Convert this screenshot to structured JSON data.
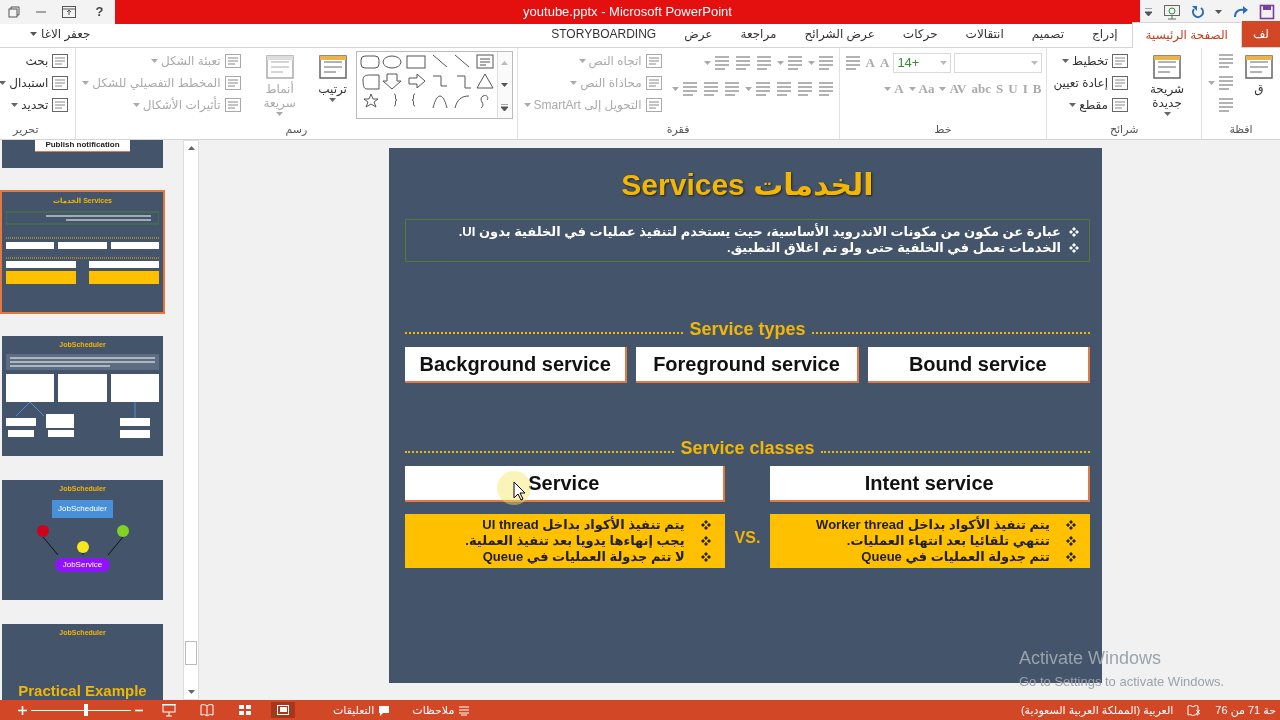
{
  "window": {
    "title": "youtube.pptx -  Microsoft PowerPoint",
    "help_label": "?"
  },
  "account": {
    "name": "جعفر الاغا"
  },
  "tabs": [
    {
      "label": "لف",
      "selected": false,
      "kind": "file"
    },
    {
      "label": "الصفحة الرئيسية",
      "selected": true,
      "kind": "tab"
    },
    {
      "label": "إدراج",
      "selected": false,
      "kind": "tab"
    },
    {
      "label": "تصميم",
      "selected": false,
      "kind": "tab"
    },
    {
      "label": "انتقالات",
      "selected": false,
      "kind": "tab"
    },
    {
      "label": "حركات",
      "selected": false,
      "kind": "tab"
    },
    {
      "label": "عرض الشرائح",
      "selected": false,
      "kind": "tab"
    },
    {
      "label": "مراجعة",
      "selected": false,
      "kind": "tab"
    },
    {
      "label": "عرض",
      "selected": false,
      "kind": "tab"
    },
    {
      "label": "STORYBOARDING",
      "selected": false,
      "kind": "tab"
    }
  ],
  "ribbon": [
    {
      "label": "افظة",
      "columns": [
        [
          {
            "kind": "large",
            "label": "ق",
            "menu": false,
            "disabled": false
          }
        ],
        [
          {
            "kind": "icon",
            "disabled": true
          },
          {
            "kind": "icon",
            "disabled": true,
            "menu": true
          },
          {
            "kind": "icon",
            "disabled": true
          }
        ]
      ]
    },
    {
      "label": "شرائح",
      "columns": [
        [
          {
            "kind": "large",
            "label": "شريحة جديدة",
            "menu": true,
            "disabled": false
          }
        ],
        [
          {
            "kind": "small",
            "label": "تخطيط",
            "menu": true,
            "disabled": false
          },
          {
            "kind": "small",
            "label": "إعادة تعيين",
            "menu": false,
            "disabled": false
          },
          {
            "kind": "small",
            "label": "مقطع",
            "menu": true,
            "disabled": false
          }
        ]
      ]
    },
    {
      "label": "خط",
      "columns": [
        [
          {
            "kind": "row",
            "items": [
              {
                "kind": "field",
                "menu": true
              },
              {
                "kind": "field",
                "value": "+14",
                "menu": true
              },
              {
                "kind": "glyph",
                "text": "A",
                "disabled": true,
                "menu": false
              },
              {
                "kind": "glyph",
                "text": "A",
                "disabled": true,
                "menu": false
              },
              {
                "kind": "icon",
                "disabled": true
              }
            ]
          },
          {
            "kind": "row",
            "items": [
              {
                "kind": "glyph",
                "text": "B",
                "disabled": true,
                "menu": false
              },
              {
                "kind": "glyph",
                "text": "I",
                "disabled": true,
                "menu": false
              },
              {
                "kind": "glyph",
                "text": "U",
                "disabled": true,
                "menu": false
              },
              {
                "kind": "glyph",
                "text": "S",
                "disabled": true,
                "menu": false
              },
              {
                "kind": "glyph",
                "text": "abc",
                "disabled": true,
                "menu": false
              },
              {
                "kind": "glyph",
                "text": "AV",
                "disabled": true,
                "menu": true
              },
              {
                "kind": "glyph",
                "text": "Aa",
                "disabled": true,
                "menu": true
              },
              {
                "kind": "glyph",
                "text": "A",
                "disabled": true,
                "menu": true
              }
            ]
          }
        ]
      ]
    },
    {
      "label": "فقرة",
      "columns": [
        [
          {
            "kind": "row",
            "items": [
              {
                "kind": "icon",
                "disabled": true,
                "menu": true
              },
              {
                "kind": "icon",
                "disabled": true,
                "menu": true
              },
              {
                "kind": "icon",
                "disabled": true
              },
              {
                "kind": "icon",
                "disabled": true
              },
              {
                "kind": "icon",
                "disabled": true,
                "menu": true
              }
            ]
          },
          {
            "kind": "row",
            "items": [
              {
                "kind": "icon",
                "disabled": true
              },
              {
                "kind": "icon",
                "disabled": true
              },
              {
                "kind": "icon",
                "disabled": true
              },
              {
                "kind": "icon",
                "disabled": true,
                "menu": true
              },
              {
                "kind": "icon",
                "disabled": true
              },
              {
                "kind": "icon",
                "disabled": true
              },
              {
                "kind": "icon",
                "disabled": true,
                "menu": true
              }
            ]
          }
        ],
        [
          {
            "kind": "small",
            "label": "اتجاه النص",
            "menu": true,
            "disabled": true
          },
          {
            "kind": "small",
            "label": "محاذاة النص",
            "menu": true,
            "disabled": true
          },
          {
            "kind": "small",
            "label": "التحويل إلى SmartArt",
            "menu": true,
            "disabled": true
          }
        ]
      ]
    },
    {
      "label": "رسم",
      "columns": [
        [
          {
            "kind": "gallery"
          }
        ],
        [
          {
            "kind": "large",
            "label": "ترتيب",
            "menu": true,
            "disabled": false
          }
        ],
        [
          {
            "kind": "large",
            "label": "أنماط سريعة",
            "menu": true,
            "disabled": true
          }
        ],
        [
          {
            "kind": "small",
            "label": "تعبئة الشكل",
            "menu": true,
            "disabled": true
          },
          {
            "kind": "small",
            "label": "المخطط التفصيلي للشكل",
            "menu": true,
            "disabled": true
          },
          {
            "kind": "small",
            "label": "تأثيرات الأشكال",
            "menu": true,
            "disabled": true
          }
        ]
      ]
    },
    {
      "label": "تحرير",
      "columns": [
        [
          {
            "kind": "small",
            "label": "بحث",
            "menu": false,
            "disabled": false
          },
          {
            "kind": "small",
            "label": "استبدال",
            "menu": true,
            "disabled": false
          },
          {
            "kind": "small",
            "label": "تحديد",
            "menu": true,
            "disabled": false
          }
        ]
      ]
    }
  ],
  "thumbnails": [
    {
      "kind": "tail",
      "selected": false,
      "texts": [
        "Publish notification"
      ]
    },
    {
      "kind": "services",
      "selected": true,
      "title": "الخدمات Services"
    },
    {
      "kind": "table",
      "selected": false,
      "title": "JobScheduler"
    },
    {
      "kind": "diagram",
      "selected": false,
      "title": "JobScheduler",
      "texts": [
        "JobScheduler",
        "JobService"
      ]
    },
    {
      "kind": "title",
      "selected": false,
      "title": "JobScheduler",
      "texts": [
        "Practical Example"
      ]
    }
  ],
  "slide": {
    "title": "الخدمات Services",
    "bullets": [
      "عبارة عن مكون من مكونات الاندرويد الأساسية، حيث يستخدم لتنفيذ عمليات في الخلفية بدون UI.",
      "الخدمات تعمل في الخلفية حتى ولو تم اغلاق التطبيق."
    ],
    "types_heading": "Service types",
    "types": [
      "Bound service",
      "Foreground service",
      "Background service"
    ],
    "classes_heading": "Service classes",
    "classes": [
      {
        "name": "Intent service",
        "points": [
          "يتم تنفيذ الأكواد بداخل Worker thread",
          "تنتهي تلقائيا بعد انتهاء العمليات.",
          "تتم جدولة العمليات في Queue"
        ]
      },
      {
        "name": "Service",
        "points": [
          "يتم تنفيذ الأكواد بداخل UI thread",
          "يجب إنهاءها يدويا بعد تنفيذ العملية.",
          "لا تتم جدولة العمليات في Queue"
        ]
      }
    ],
    "versus": "VS."
  },
  "activation_notice": {
    "title": "Activate Windows",
    "text": "Go to Settings to activate Windows."
  },
  "status_bar": {
    "slide_counter": "حة 71 من 76",
    "language": "العربية (المملكة العربية السعودية)",
    "notes": "ملاحظات",
    "comments": "التعليقات",
    "zoom": {
      "level": 0.55
    },
    "views": [
      {
        "kind": "slideshow",
        "selected": false
      },
      {
        "kind": "reading",
        "selected": false
      },
      {
        "kind": "sorter",
        "selected": false
      },
      {
        "kind": "normal",
        "selected": true
      }
    ]
  }
}
